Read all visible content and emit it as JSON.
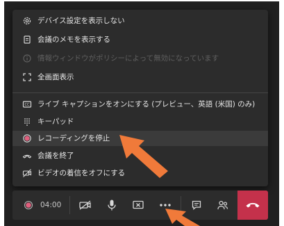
{
  "menu": {
    "items": [
      {
        "label": "デバイス設定を表示しない",
        "icon": "gear-icon",
        "enabled": true
      },
      {
        "label": "会議のメモを表示する",
        "icon": "notes-icon",
        "enabled": true
      },
      {
        "label": "情報ウィンドウがポリシーによって無効になっています",
        "icon": "info-icon",
        "enabled": false
      },
      {
        "label": "全画面表示",
        "icon": "fullscreen-icon",
        "enabled": true
      },
      {
        "label": "ライブ キャプションをオンにする (プレビュー、英語 (米国) のみ)",
        "icon": "captions-icon",
        "enabled": true
      },
      {
        "label": "キーパッド",
        "icon": "keypad-icon",
        "enabled": true
      },
      {
        "label": "レコーディングを停止",
        "icon": "record-stop-icon",
        "enabled": true,
        "highlighted": true
      },
      {
        "label": "会議を終了",
        "icon": "end-call-icon",
        "enabled": true
      },
      {
        "label": "ビデオの着信をオフにする",
        "icon": "video-off-icon",
        "enabled": true
      }
    ]
  },
  "toolbar": {
    "timer": "04:00",
    "recording_indicator_color": "#e0607e",
    "buttons": [
      {
        "name": "camera-off-button",
        "icon": "camera-off-icon"
      },
      {
        "name": "microphone-button",
        "icon": "microphone-icon"
      },
      {
        "name": "share-screen-button",
        "icon": "share-icon"
      },
      {
        "name": "more-actions-button",
        "icon": "more-icon"
      },
      {
        "name": "chat-button",
        "icon": "chat-icon"
      },
      {
        "name": "participants-button",
        "icon": "participants-icon"
      },
      {
        "name": "hang-up-button",
        "icon": "hang-up-icon"
      }
    ]
  },
  "colors": {
    "menu_bg": "#2c2c2c",
    "highlight_bg": "#3b3b3b",
    "hangup": "#c4314b",
    "annotation_arrow": "#f07a3a"
  }
}
